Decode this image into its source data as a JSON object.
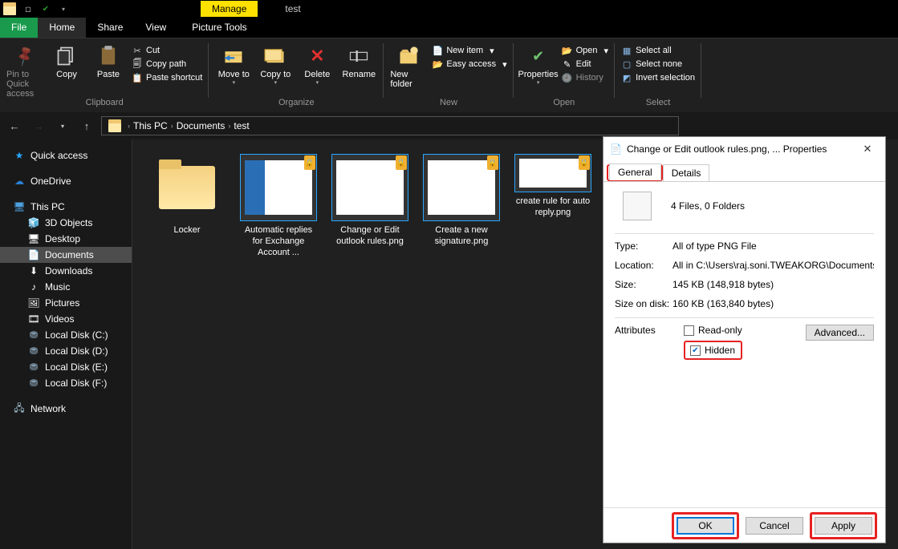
{
  "window_title": "test",
  "context_tabs": {
    "manage": "Manage",
    "picture_tools": "Picture Tools"
  },
  "menu": {
    "file": "File",
    "home": "Home",
    "share": "Share",
    "view": "View"
  },
  "ribbon": {
    "clipboard": {
      "label": "Clipboard",
      "pin": "Pin to Quick access",
      "copy": "Copy",
      "paste": "Paste",
      "cut": "Cut",
      "copy_path": "Copy path",
      "paste_shortcut": "Paste shortcut"
    },
    "organize": {
      "label": "Organize",
      "move_to": "Move to",
      "copy_to": "Copy to",
      "delete": "Delete",
      "rename": "Rename"
    },
    "new": {
      "label": "New",
      "new_folder": "New folder",
      "new_item": "New item",
      "easy_access": "Easy access"
    },
    "open": {
      "label": "Open",
      "properties": "Properties",
      "open": "Open",
      "edit": "Edit",
      "history": "History"
    },
    "select": {
      "label": "Select",
      "select_all": "Select all",
      "select_none": "Select none",
      "invert": "Invert selection"
    }
  },
  "breadcrumb": [
    "This PC",
    "Documents",
    "test"
  ],
  "sidebar": {
    "quick_access": "Quick access",
    "onedrive": "OneDrive",
    "this_pc": "This PC",
    "objects3d": "3D Objects",
    "desktop": "Desktop",
    "documents": "Documents",
    "downloads": "Downloads",
    "music": "Music",
    "pictures": "Pictures",
    "videos": "Videos",
    "disk_c": "Local Disk (C:)",
    "disk_d": "Local Disk (D:)",
    "disk_e": "Local Disk (E:)",
    "disk_f": "Local Disk (F:)",
    "network": "Network"
  },
  "files": [
    {
      "name": "Locker",
      "type": "folder"
    },
    {
      "name": "Automatic replies for Exchange Account ...",
      "type": "png"
    },
    {
      "name": "Change or Edit outlook rules.png",
      "type": "png"
    },
    {
      "name": "Create a new signature.png",
      "type": "png"
    },
    {
      "name": "create rule for auto reply.png",
      "type": "png"
    }
  ],
  "dialog": {
    "title": "Change or Edit outlook rules.png, ... Properties",
    "tabs": {
      "general": "General",
      "details": "Details"
    },
    "summary": "4 Files, 0 Folders",
    "rows": {
      "type_k": "Type:",
      "type_v": "All of type PNG File",
      "location_k": "Location:",
      "location_v": "All in C:\\Users\\raj.soni.TWEAKORG\\Documents\\tes",
      "size_k": "Size:",
      "size_v": "145 KB (148,918 bytes)",
      "size_disk_k": "Size on disk:",
      "size_disk_v": "160 KB (163,840 bytes)",
      "attributes_k": "Attributes"
    },
    "readonly": "Read-only",
    "hidden": "Hidden",
    "advanced": "Advanced...",
    "buttons": {
      "ok": "OK",
      "cancel": "Cancel",
      "apply": "Apply"
    }
  }
}
